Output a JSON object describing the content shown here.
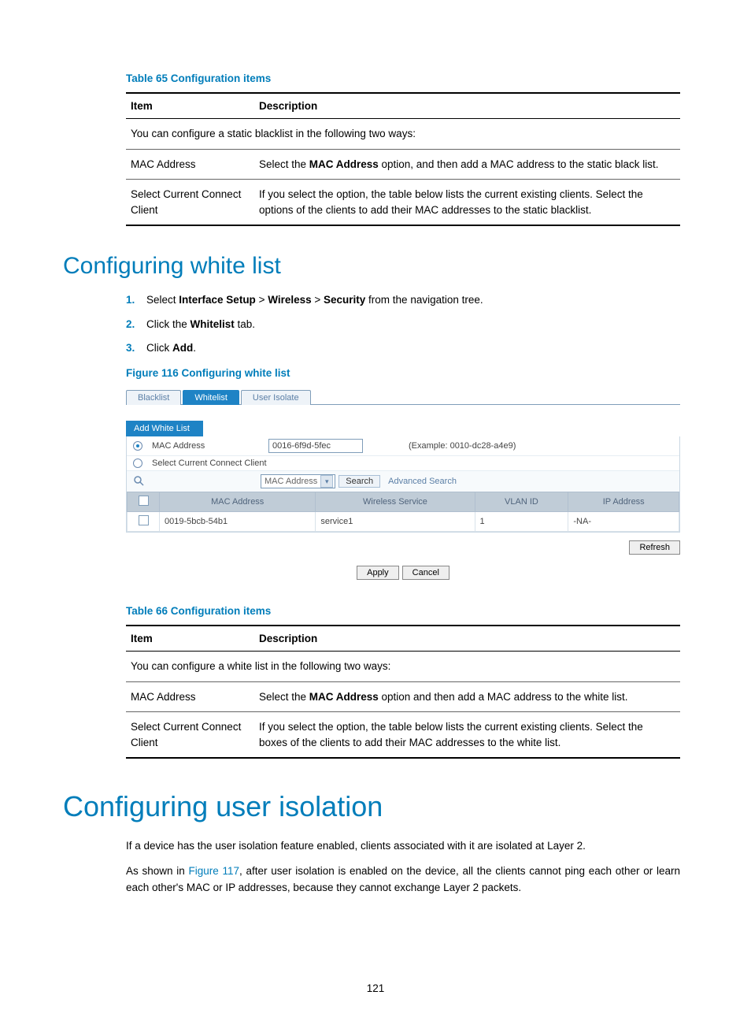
{
  "table65": {
    "caption": "Table 65 Configuration items",
    "headers": {
      "item": "Item",
      "desc": "Description"
    },
    "intro": "You can configure a static blacklist in the following two ways:",
    "rows": [
      {
        "item": "MAC Address",
        "desc_pre": "Select the ",
        "desc_bold": "MAC Address",
        "desc_post": " option, and then add a MAC address to the static black list."
      },
      {
        "item": "Select Current Connect Client",
        "desc": "If you select the option, the table below lists the current existing clients. Select the options of the clients to add their MAC addresses to the static blacklist."
      }
    ]
  },
  "heading_whitelist": "Configuring white list",
  "steps_whitelist": [
    {
      "num": "1.",
      "pre": "Select ",
      "b1": "Interface Setup",
      "mid1": " > ",
      "b2": "Wireless",
      "mid2": " > ",
      "b3": "Security",
      "post": " from the navigation tree."
    },
    {
      "num": "2.",
      "pre": "Click the ",
      "b1": "Whitelist",
      "post": " tab."
    },
    {
      "num": "3.",
      "pre": "Click ",
      "b1": "Add",
      "post": "."
    }
  ],
  "figure116": {
    "caption": "Figure 116 Configuring white list",
    "tabs": {
      "blacklist": "Blacklist",
      "whitelist": "Whitelist",
      "userisolate": "User Isolate"
    },
    "section_bar": "Add White List",
    "mac_label": "MAC Address",
    "mac_value": "0016-6f9d-5fec",
    "mac_example": "(Example: 0010-dc28-a4e9)",
    "select_client_label": "Select Current Connect Client",
    "search_field_label": "MAC Address",
    "search_btn": "Search",
    "adv_search": "Advanced Search",
    "grid_headers": {
      "mac": "MAC Address",
      "ws": "Wireless Service",
      "vlan": "VLAN ID",
      "ip": "IP Address"
    },
    "grid_row": {
      "mac": "0019-5bcb-54b1",
      "ws": "service1",
      "vlan": "1",
      "ip": "-NA-"
    },
    "refresh_btn": "Refresh",
    "apply_btn": "Apply",
    "cancel_btn": "Cancel"
  },
  "table66": {
    "caption": "Table 66 Configuration items",
    "headers": {
      "item": "Item",
      "desc": "Description"
    },
    "intro": "You can configure a white list in the following two ways:",
    "rows": [
      {
        "item": "MAC Address",
        "desc_pre": "Select the ",
        "desc_bold": "MAC Address",
        "desc_post": " option and then add a MAC address to the white list."
      },
      {
        "item": "Select Current Connect Client",
        "desc": "If you select the option, the table below lists the current existing clients. Select the boxes of the clients to add their MAC addresses to the white list."
      }
    ]
  },
  "heading_isolation": "Configuring user isolation",
  "isolation_p1": "If a device has the user isolation feature enabled, clients associated with it are isolated at Layer 2.",
  "isolation_p2_pre": "As shown in ",
  "isolation_p2_link": "Figure 117",
  "isolation_p2_post": ", after user isolation is enabled on the device, all the clients cannot ping each other or learn each other's MAC or IP addresses, because they cannot exchange Layer 2 packets.",
  "page_number": "121"
}
